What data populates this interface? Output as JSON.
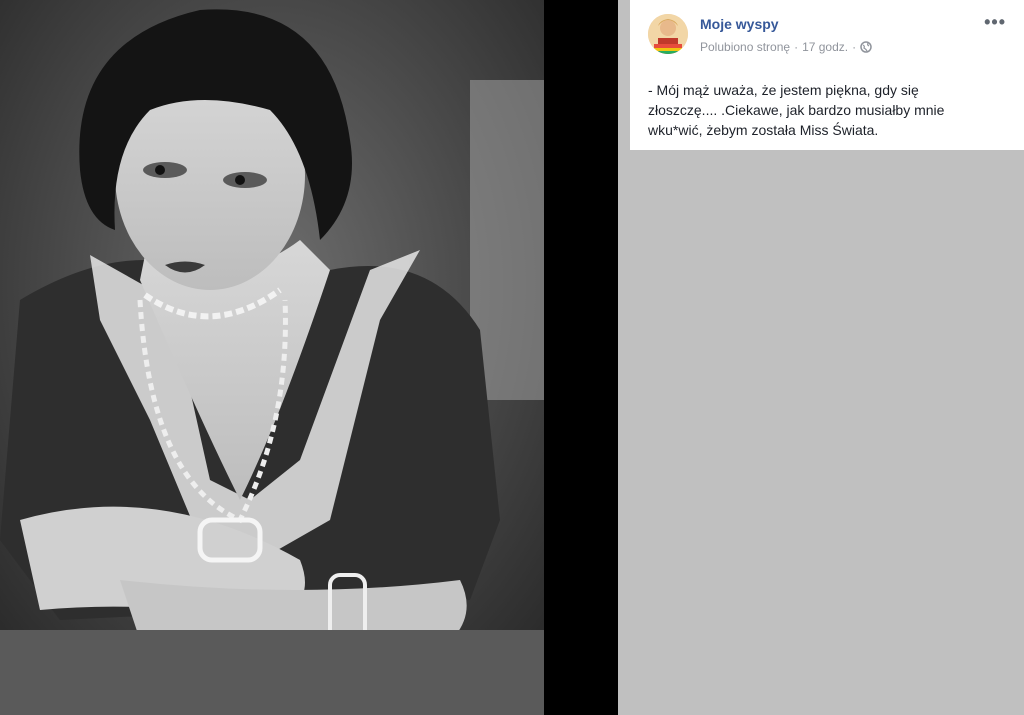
{
  "post": {
    "page_name": "Moje wyspy",
    "liked_label": "Polubiono stronę",
    "time": "17 godz.",
    "separator": "·",
    "more_label": "•••",
    "text": "- Mój mąż uważa, że jestem piękna, gdy się złoszczę.... .Ciekawe, jak bardzo musiałby mnie wku*wić, żebym została Miss Świata.",
    "privacy_icon": "globe-icon"
  },
  "photo": {
    "subject": "black-and-white portrait photo"
  },
  "colors": {
    "link": "#365899",
    "meta": "#90949c",
    "panel": "#c0c0c0"
  }
}
